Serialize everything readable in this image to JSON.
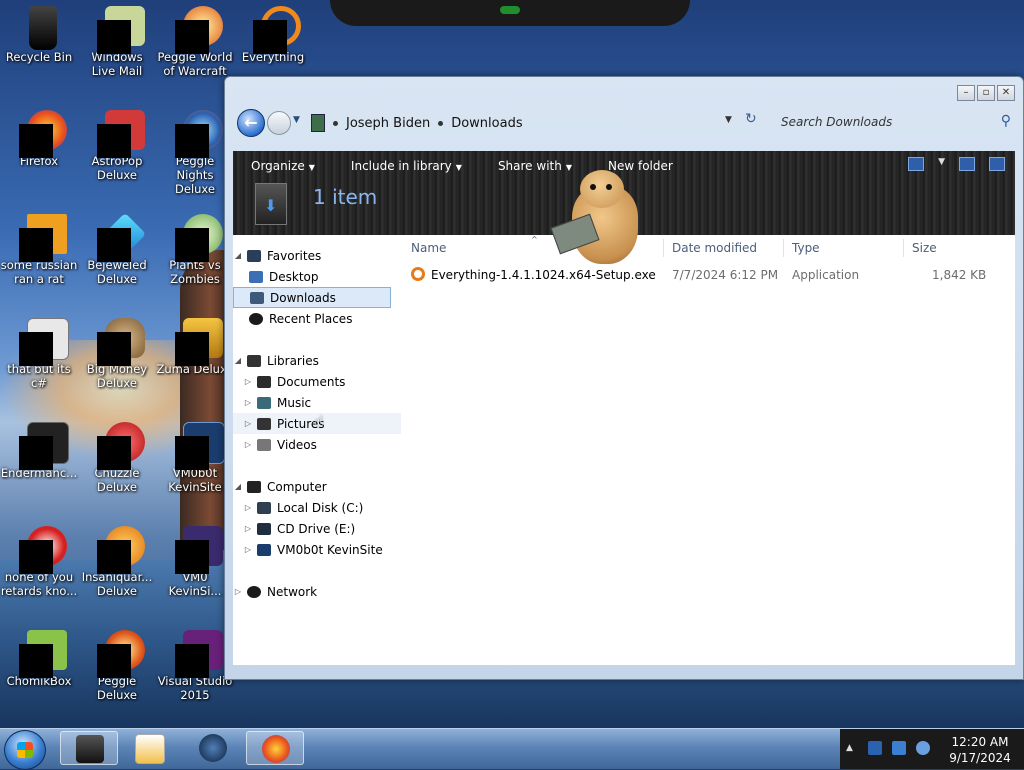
{
  "desktop": {
    "icons": [
      {
        "label": "Recycle Bin",
        "art": "recycle-bin-icon"
      },
      {
        "label": "Windows Live Mail",
        "art": "windows-live-mail-icon"
      },
      {
        "label": "Peggle World of Warcraft",
        "art": "peggle-wow-icon"
      },
      {
        "label": "Everything",
        "art": "everything-search-icon"
      },
      {
        "label": "Firefox",
        "art": "firefox-icon"
      },
      {
        "label": "AstroPop Deluxe",
        "art": "astropop-icon"
      },
      {
        "label": "Peggle Nights Deluxe",
        "art": "peggle-nights-icon"
      },
      {
        "label": "some russian ran a rat",
        "art": "russian-file-icon"
      },
      {
        "label": "Bejeweled Deluxe",
        "art": "bejeweled-icon"
      },
      {
        "label": "Plants vs Zombies",
        "art": "plants-vs-zombies-icon"
      },
      {
        "label": "that but its c#",
        "art": "c-sharp-file-icon"
      },
      {
        "label": "Big Money Deluxe",
        "art": "big-money-icon"
      },
      {
        "label": "Zuma Deluxe",
        "art": "zuma-icon"
      },
      {
        "label": "Endermanc...",
        "art": "endermanc-icon"
      },
      {
        "label": "Chuzzle Deluxe",
        "art": "chuzzle-icon"
      },
      {
        "label": "VM0b0t KevinSite",
        "art": "vm-kevinsite-icon"
      },
      {
        "label": "none of you retards kno...",
        "art": "none-of-you-icon"
      },
      {
        "label": "Insaniquar... Deluxe",
        "art": "insaniquarium-icon"
      },
      {
        "label": "VM0 KevinSi...",
        "art": "vm0-kevinsite-icon"
      },
      {
        "label": "ChomikBox",
        "art": "chomikbox-icon"
      },
      {
        "label": "Peggle Deluxe",
        "art": "peggle-icon"
      },
      {
        "label": "Visual Studio 2015",
        "art": "visual-studio-icon"
      }
    ]
  },
  "explorer": {
    "breadcrumb": [
      "Joseph Biden",
      "Downloads"
    ],
    "search_placeholder": "Search Downloads",
    "toolbar": {
      "organize": "Organize",
      "include_in_library": "Include in library",
      "share_with": "Share with",
      "new_folder": "New folder"
    },
    "item_count": "1 item",
    "nav": {
      "favorites": "Favorites",
      "desktop": "Desktop",
      "downloads": "Downloads",
      "recent_places": "Recent Places",
      "libraries": "Libraries",
      "documents": "Documents",
      "music": "Music",
      "pictures": "Pictures",
      "videos": "Videos",
      "computer": "Computer",
      "local_disk": "Local Disk (C:)",
      "cd_drive": "CD Drive (E:)",
      "vm_kevinsite": "VM0b0t KevinSite",
      "network": "Network"
    },
    "columns": {
      "name": "Name",
      "date_modified": "Date modified",
      "type": "Type",
      "size": "Size"
    },
    "files": [
      {
        "name": "Everything-1.4.1.1024.x64-Setup.exe",
        "date": "7/7/2024 6:12 PM",
        "type": "Application",
        "size": "1,842 KB"
      }
    ]
  },
  "taskbar": {
    "time": "12:20 AM",
    "date": "9/17/2024",
    "apps": [
      "explorer-app-icon",
      "media-player-icon",
      "globe-app-icon",
      "firefox-taskbar-icon"
    ]
  }
}
